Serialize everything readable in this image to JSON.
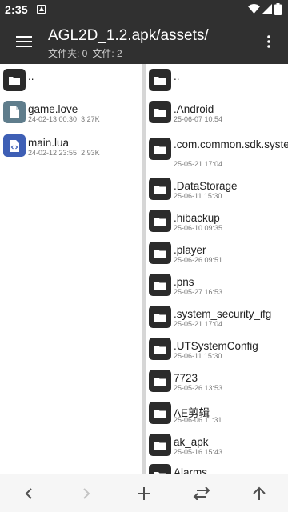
{
  "status_bar": {
    "time": "2:35"
  },
  "app_bar": {
    "title": "AGL2D_1.2.apk/assets/",
    "subtitle_folders": "文件夹: 0",
    "subtitle_files": "文件: 2"
  },
  "left_pane": {
    "parent_label": "..",
    "items": [
      {
        "name": "game.love",
        "date": "24-02-13 00:30",
        "size": "3.27K",
        "icon": "file-icon"
      },
      {
        "name": "main.lua",
        "date": "24-02-12 23:55",
        "size": "2.93K",
        "icon": "code-file-icon"
      }
    ]
  },
  "right_pane": {
    "parent_label": "..",
    "items": [
      {
        "name": ".Android",
        "date": "25-06-07 10:54"
      },
      {
        "name": ".com.common.sdk.system",
        "date": "25-05-21 17:04"
      },
      {
        "name": ".DataStorage",
        "date": "25-06-11 15:30"
      },
      {
        "name": ".hibackup",
        "date": "25-06-10 09:35"
      },
      {
        "name": ".player",
        "date": "25-06-26 09:51"
      },
      {
        "name": ".pns",
        "date": "25-05-27 16:53"
      },
      {
        "name": ".system_security_ifg",
        "date": "25-05-21 17:04"
      },
      {
        "name": ".UTSystemConfig",
        "date": "25-06-11 15:30"
      },
      {
        "name": "7723",
        "date": "25-05-26 13:53"
      },
      {
        "name": "AE剪辑",
        "date": "25-06-06 11:31"
      },
      {
        "name": "ak_apk",
        "date": "25-05-16 15:43"
      },
      {
        "name": "Alarms",
        "date": ""
      }
    ]
  },
  "bottom_bar": {
    "buttons": [
      "back",
      "forward",
      "add",
      "swap",
      "up"
    ]
  },
  "colors": {
    "app_bar": "#303030",
    "folder_icon": "#2b2b2b",
    "file_icon": "#5f7d8c",
    "code_icon": "#3e5fb5"
  }
}
